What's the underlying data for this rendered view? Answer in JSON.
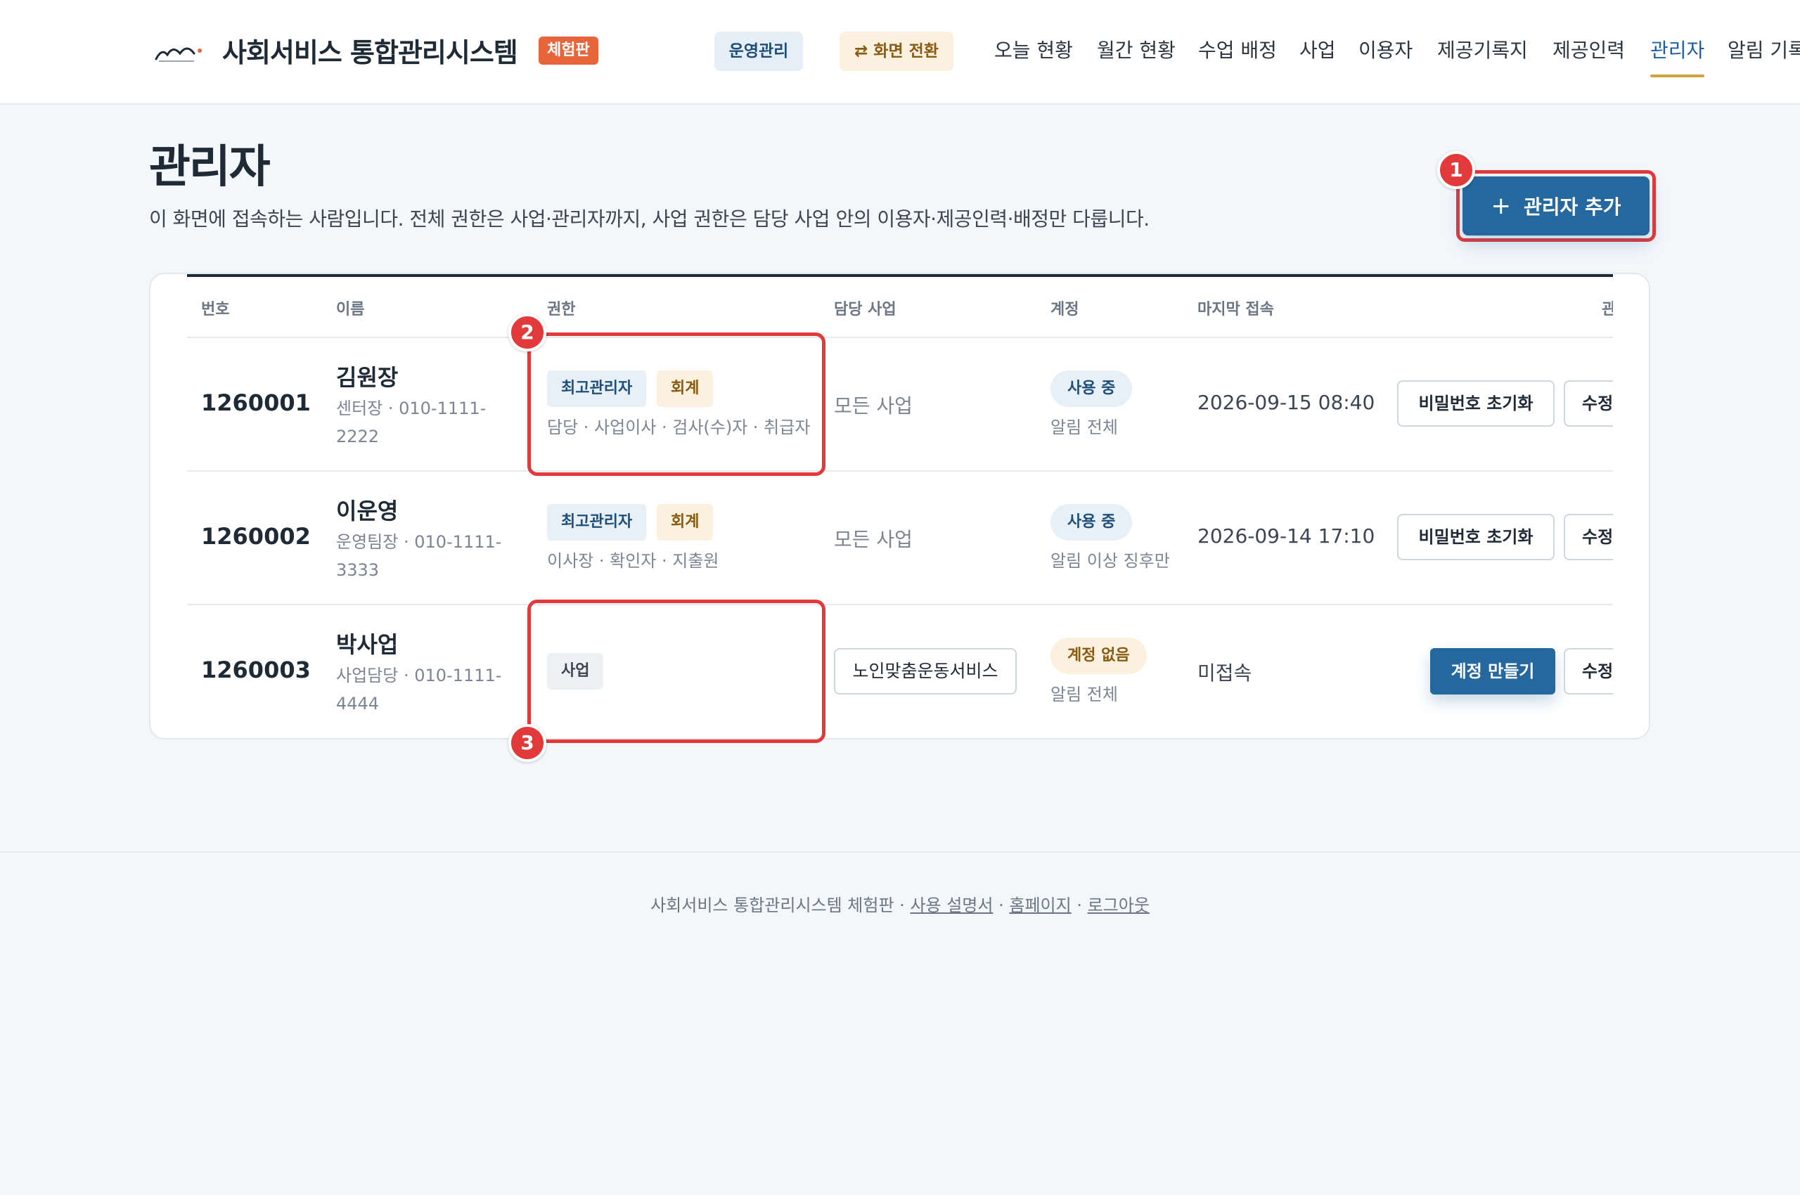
{
  "header": {
    "brand_title": "사회서비스 통합관리시스템",
    "trial_badge": "체험판",
    "ops_pill": "운영관리",
    "switch_pill": "⇄ 화면 전환",
    "nav": [
      {
        "label": "오늘 현황",
        "active": false
      },
      {
        "label": "월간 현황",
        "active": false
      },
      {
        "label": "수업 배정",
        "active": false
      },
      {
        "label": "사업",
        "active": false
      },
      {
        "label": "이용자",
        "active": false
      },
      {
        "label": "제공기록지",
        "active": false
      },
      {
        "label": "제공인력",
        "active": false
      },
      {
        "label": "관리자",
        "active": true
      },
      {
        "label": "알림 기록",
        "active": false
      }
    ]
  },
  "page": {
    "title": "관리자",
    "description": "이 화면에 접속하는 사람입니다. 전체 권한은 사업·관리자까지, 사업 권한은 담당 사업 안의 이용자·제공인력·배정만 다룹니다.",
    "add_button": "관리자 추가",
    "add_icon": "plus-icon"
  },
  "markers": [
    "1",
    "2",
    "3"
  ],
  "table": {
    "headers": [
      "번호",
      "이름",
      "권한",
      "담당 사업",
      "계정",
      "마지막 접속",
      "관리"
    ],
    "rows": [
      {
        "id": "1260001",
        "name": "김원장",
        "sub": "센터장 · 010-1111-2222",
        "tags": [
          "최고관리자",
          "회계"
        ],
        "roles": "담당 · 사업이사 · 검사(수)자 · 취급자",
        "business": "모든 사업",
        "status": "사용 중",
        "alert": "알림 전체",
        "last_login": "2026-09-15 08:40",
        "action": "비밀번호 초기화",
        "edit": "수정"
      },
      {
        "id": "1260002",
        "name": "이운영",
        "sub": "운영팀장 · 010-1111-3333",
        "tags": [
          "최고관리자",
          "회계"
        ],
        "roles": "이사장 · 확인자 · 지출원",
        "business": "모든 사업",
        "status": "사용 중",
        "alert": "알림 이상 징후만",
        "last_login": "2026-09-14 17:10",
        "action": "비밀번호 초기화",
        "edit": "수정"
      },
      {
        "id": "1260003",
        "name": "박사업",
        "sub": "사업담당 · 010-1111-4444",
        "tags": [
          "사업"
        ],
        "roles": "",
        "business": "노인맞춤운동서비스",
        "status": "계정 없음",
        "alert": "알림 전체",
        "last_login": "미접속",
        "action": "계정 만들기",
        "edit": "수정"
      }
    ]
  },
  "footer": {
    "prefix": "사회서비스 통합관리시스템 체험판 · ",
    "link_manual": "사용 설명서",
    "sep1": " · ",
    "link_home": "홈페이지",
    "sep2": " · ",
    "link_logout": "로그아웃"
  },
  "colors": {
    "primary": "#25679f",
    "accent_red": "#e23a3a",
    "badge_orange": "#e8653c",
    "nav_active": "#1f5fa3",
    "nav_underline": "#d4a23b"
  }
}
